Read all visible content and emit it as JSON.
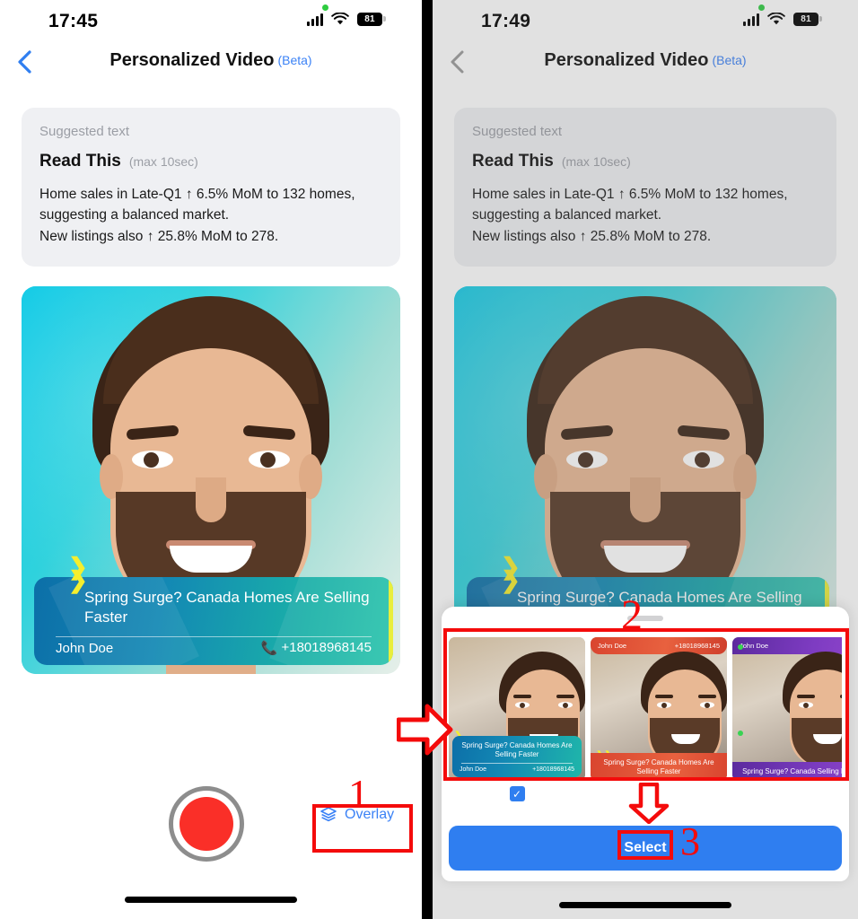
{
  "left_phone": {
    "status": {
      "time": "17:45",
      "battery": "81",
      "signal_icon": "cellular-bars-icon",
      "wifi_icon": "wifi-icon",
      "recording_dot": "green-dot-icon"
    },
    "nav": {
      "back_icon": "chevron-left-icon",
      "title": "Personalized Video",
      "badge": "(Beta)"
    },
    "suggested_card": {
      "label": "Suggested text",
      "heading": "Read This",
      "limit": "(max 10sec)",
      "line1": "Home sales in Late-Q1 ↑ 6.5% MoM to 132 homes,",
      "line2": "suggesting a balanced market.",
      "line3": "New listings also ↑ 25.8% MoM to 278."
    },
    "video_overlay": {
      "title": "Spring Surge? Canada Homes Are Selling Faster",
      "name": "John Doe",
      "phone": "+18018968145",
      "phone_icon": "phone-icon",
      "chevron_icon": "double-chevron-down-icon"
    },
    "controls": {
      "record_label": "record-button",
      "overlay_label": "Overlay",
      "overlay_icon": "layers-icon"
    }
  },
  "right_phone": {
    "status": {
      "time": "17:49",
      "battery": "81"
    },
    "nav": {
      "title": "Personalized Video",
      "badge": "(Beta)"
    },
    "sheet": {
      "grab_handle": "drag-handle",
      "select_label": "Select",
      "checkbox_icon": "check-icon",
      "thumbnails": [
        {
          "theme": "teal",
          "selected": true,
          "title": "Spring Surge? Canada Homes Are Selling Faster",
          "name": "John Doe",
          "phone": "+18018968145"
        },
        {
          "theme": "red",
          "selected": false,
          "title": "Spring Surge? Canada Homes Are Selling Faster",
          "name": "John Doe",
          "phone": "+18018968145"
        },
        {
          "theme": "purple",
          "selected": false,
          "title": "Spring Surge? Canada Selling Faste",
          "name": "John Doe",
          "phone": ""
        }
      ]
    }
  },
  "annotations": {
    "step1": "1",
    "step2": "2",
    "step3": "3",
    "flow_arrow_icon": "right-arrow-outline-icon",
    "down_arrow_icon": "down-arrow-outline-icon",
    "color": "#f40b0b"
  }
}
